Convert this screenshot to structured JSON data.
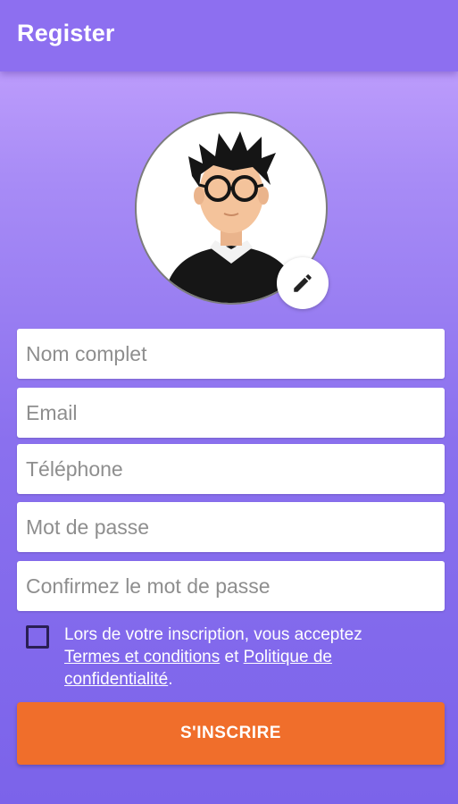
{
  "app_bar": {
    "title": "Register"
  },
  "profile": {
    "avatar_icon": "user-avatar-icon",
    "edit_icon": "pencil-icon"
  },
  "form": {
    "full_name_placeholder": "Nom complet",
    "email_placeholder": "Email",
    "phone_placeholder": "Téléphone",
    "password_placeholder": "Mot de passe",
    "confirm_password_placeholder": "Confirmez le mot de passe"
  },
  "terms": {
    "prefix": "Lors de votre inscription, vous acceptez ",
    "terms_link": "Termes et conditions",
    "middle": " et ",
    "privacy_link": "Politique de confidentialité",
    "suffix": ".",
    "checked": false
  },
  "submit_label": "S'INSCRIRE",
  "colors": {
    "app_bar": "#8d6ff0",
    "button": "#f06e2b",
    "background_top": "#c9a6ff",
    "background_bottom": "#7b63ea"
  }
}
